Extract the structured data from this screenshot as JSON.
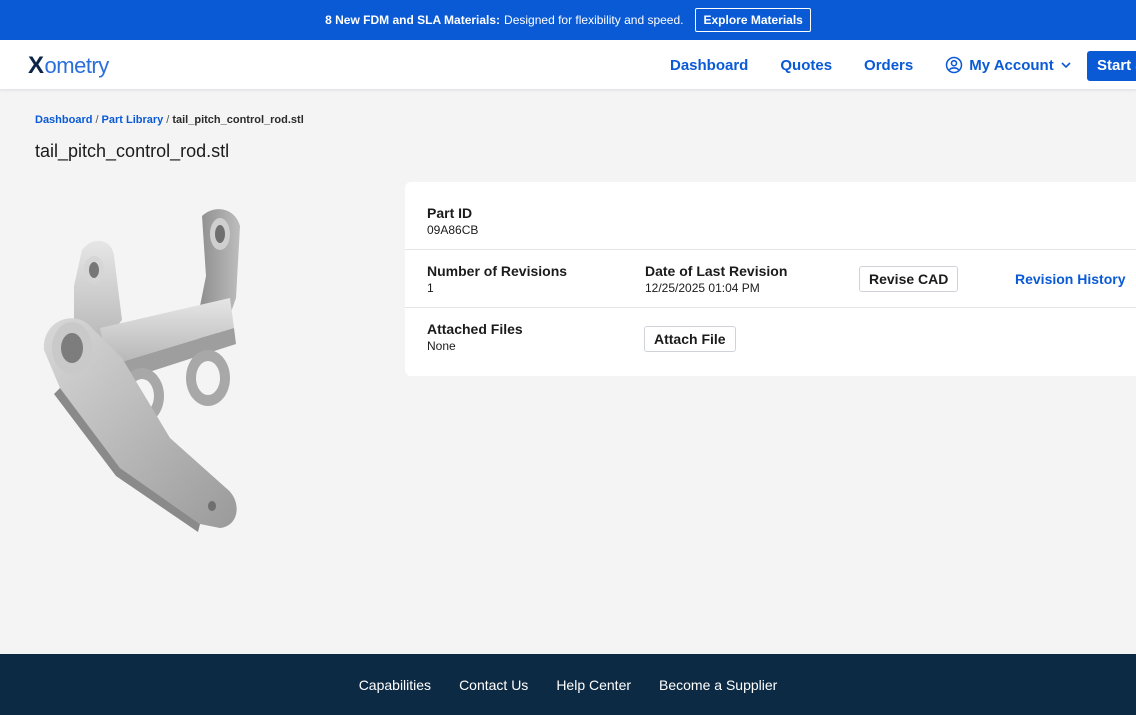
{
  "promo": {
    "bold_text": "8 New FDM and SLA Materials:",
    "text": "Designed for flexibility and speed.",
    "button": "Explore Materials"
  },
  "nav": {
    "logo_x": "X",
    "logo_rest": "ometry",
    "links": [
      "Dashboard",
      "Quotes",
      "Orders"
    ],
    "account": "My Account",
    "start": "Start a"
  },
  "breadcrumb": {
    "items": [
      "Dashboard",
      "Part Library",
      "tail_pitch_control_rod.stl"
    ],
    "separator": "/"
  },
  "page_title": "tail_pitch_control_rod.stl",
  "part": {
    "id_label": "Part ID",
    "id_value": "09A86CB",
    "revisions_label": "Number of Revisions",
    "revisions_value": "1",
    "last_revision_label": "Date of Last Revision",
    "last_revision_value": "12/25/2025 01:04 PM",
    "revise_button": "Revise CAD",
    "history_link": "Revision History",
    "files_label": "Attached Files",
    "files_value": "None",
    "attach_button": "Attach File"
  },
  "footer": {
    "links": [
      "Capabilities",
      "Contact Us",
      "Help Center",
      "Become a Supplier"
    ]
  },
  "colors": {
    "brand_blue": "#0a5ad6",
    "footer_navy": "#0d2a44",
    "page_bg": "#f4f4f4"
  },
  "icons": {
    "account": "user-circle-icon",
    "chevron": "chevron-down-icon"
  }
}
